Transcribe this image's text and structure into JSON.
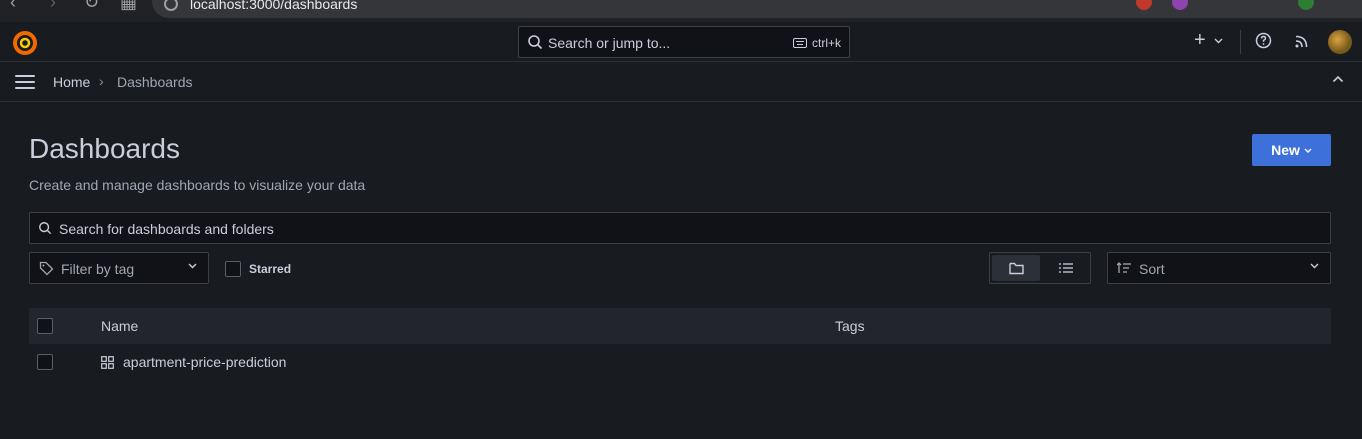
{
  "browser": {
    "url": "localhost:3000/dashboards"
  },
  "topbar": {
    "search_placeholder": "Search or jump to...",
    "search_shortcut": "ctrl+k",
    "add_label": "+"
  },
  "breadcrumb": {
    "home": "Home",
    "separator": "›",
    "current": "Dashboards"
  },
  "page": {
    "title": "Dashboards",
    "subtitle": "Create and manage dashboards to visualize your data",
    "new_button": "New"
  },
  "filters": {
    "search_placeholder": "Search for dashboards and folders",
    "tag_placeholder": "Filter by tag",
    "starred_label": "Starred",
    "sort_placeholder": "Sort"
  },
  "table": {
    "columns": [
      "Name",
      "Tags"
    ],
    "rows": [
      {
        "name": "apartment-price-prediction",
        "tags": ""
      }
    ]
  },
  "colors": {
    "background": "#181b1f",
    "accent": "#3d71d9",
    "text": "#ccccdc"
  }
}
